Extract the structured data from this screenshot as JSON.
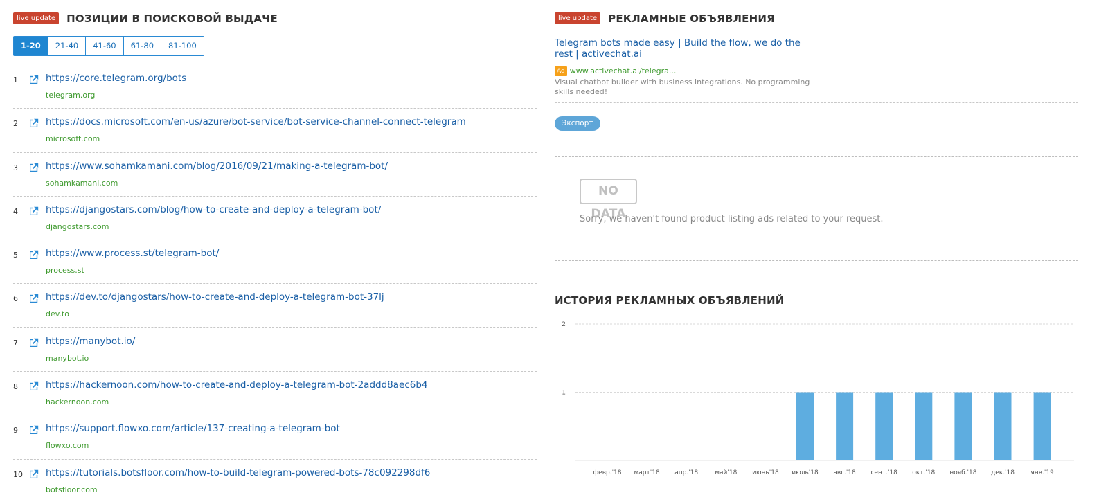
{
  "left": {
    "badge": "live update",
    "title": "ПОЗИЦИИ В ПОИСКОВОЙ ВЫДАЧЕ",
    "tabs": [
      "1-20",
      "21-40",
      "41-60",
      "61-80",
      "81-100"
    ],
    "active_tab": "1-20",
    "results": [
      {
        "num": "1",
        "url": "https://core.telegram.org/bots",
        "domain": "telegram.org"
      },
      {
        "num": "2",
        "url": "https://docs.microsoft.com/en-us/azure/bot-service/bot-service-channel-connect-telegram",
        "domain": "microsoft.com"
      },
      {
        "num": "3",
        "url": "https://www.sohamkamani.com/blog/2016/09/21/making-a-telegram-bot/",
        "domain": "sohamkamani.com"
      },
      {
        "num": "4",
        "url": "https://djangostars.com/blog/how-to-create-and-deploy-a-telegram-bot/",
        "domain": "djangostars.com"
      },
      {
        "num": "5",
        "url": "https://www.process.st/telegram-bot/",
        "domain": "process.st"
      },
      {
        "num": "6",
        "url": "https://dev.to/djangostars/how-to-create-and-deploy-a-telegram-bot-37lj",
        "domain": "dev.to"
      },
      {
        "num": "7",
        "url": "https://manybot.io/",
        "domain": "manybot.io"
      },
      {
        "num": "8",
        "url": "https://hackernoon.com/how-to-create-and-deploy-a-telegram-bot-2addd8aec6b4",
        "domain": "hackernoon.com"
      },
      {
        "num": "9",
        "url": "https://support.flowxo.com/article/137-creating-a-telegram-bot",
        "domain": "flowxo.com"
      },
      {
        "num": "10",
        "url": "https://tutorials.botsfloor.com/how-to-build-telegram-powered-bots-78c092298df6",
        "domain": "botsfloor.com"
      }
    ]
  },
  "right": {
    "badge": "live update",
    "title": "РЕКЛАМНЫЕ ОБЪЯВЛЕНИЯ",
    "ad": {
      "title": "Telegram bots made easy | Build the flow, we do the rest | activechat.ai",
      "tag": "Ad",
      "url": "www.activechat.ai/telegra...",
      "description": "Visual chatbot builder with business integrations. No programming skills needed!"
    },
    "export_label": "Экспорт",
    "no_data": {
      "badge": "NO DATA",
      "message": "Sorry, we haven't found product listing ads related to your request."
    },
    "history_title": "ИСТОРИЯ РЕКЛАМНЫХ ОБЪЯВЛЕНИЙ"
  },
  "colors": {
    "badge": "#c9442f",
    "link": "#1a5fa6",
    "domain": "#3f9a2f",
    "tab_active": "#1f86d1",
    "bar": "#5eade0",
    "ad_tag": "#f6a11a"
  },
  "chart_data": {
    "type": "bar",
    "categories": [
      "февр.'18",
      "март'18",
      "апр.'18",
      "май'18",
      "июнь'18",
      "июль'18",
      "авг.'18",
      "сент.'18",
      "окт.'18",
      "нояб.'18",
      "дек.'18",
      "янв.'19"
    ],
    "values": [
      0,
      0,
      0,
      0,
      0,
      1,
      1,
      1,
      1,
      1,
      1,
      1
    ],
    "yticks": [
      1,
      2
    ],
    "ylim": [
      0,
      2
    ],
    "grid": true
  }
}
